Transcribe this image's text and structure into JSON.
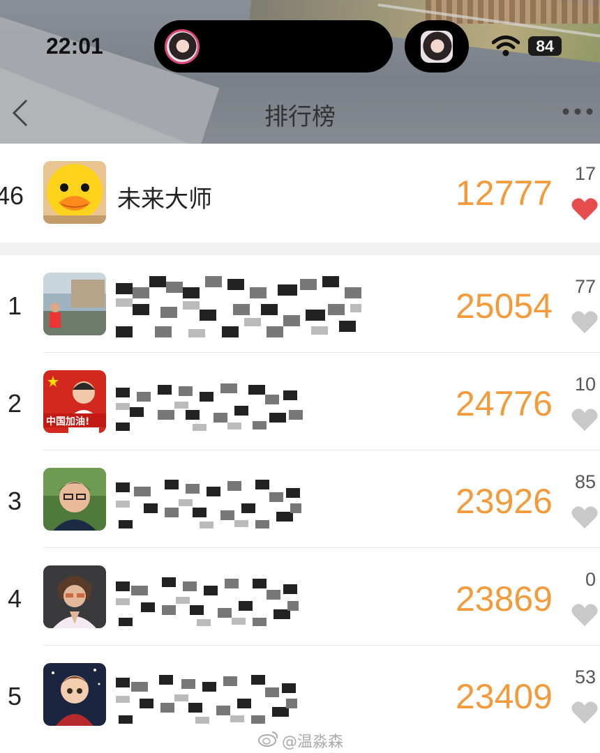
{
  "status_bar": {
    "time": "22:01",
    "battery": "84"
  },
  "nav": {
    "title": "排行榜"
  },
  "my_entry": {
    "rank": "46",
    "name": "未来大师",
    "score": "12777",
    "likes": "17",
    "liked": true
  },
  "leaderboard": [
    {
      "rank": "1",
      "score": "25054",
      "likes": "77",
      "liked": false
    },
    {
      "rank": "2",
      "score": "24776",
      "likes": "10",
      "liked": false
    },
    {
      "rank": "3",
      "score": "23926",
      "likes": "85",
      "liked": false
    },
    {
      "rank": "4",
      "score": "23869",
      "likes": "0",
      "liked": false
    },
    {
      "rank": "5",
      "score": "23409",
      "likes": "53",
      "liked": false
    }
  ],
  "watermark": "@温淼森",
  "colors": {
    "score": "#f39a3b",
    "heart_active": "#e84d4d",
    "heart_inactive": "#c9c9c9"
  },
  "icons": [
    "back-chevron-icon",
    "more-dots-icon",
    "wifi-icon",
    "heart-icon",
    "weibo-icon"
  ]
}
